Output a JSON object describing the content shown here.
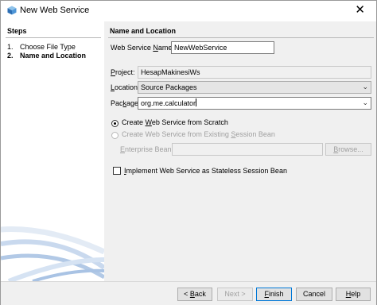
{
  "window": {
    "title": "New Web Service",
    "close_glyph": "✕"
  },
  "steps": {
    "heading": "Steps",
    "items": [
      {
        "num": "1.",
        "label": "Choose File Type"
      },
      {
        "num": "2.",
        "label": "Name and Location"
      }
    ]
  },
  "panel": {
    "heading": "Name and Location",
    "web_service_name": {
      "label_pre": "Web Service ",
      "label_mn": "N",
      "label_post": "ame:",
      "value": "NewWebService"
    },
    "project": {
      "label_mn": "P",
      "label_post": "roject:",
      "value": "HesapMakinesiWs"
    },
    "location": {
      "label_mn": "L",
      "label_post": "ocation:",
      "value": "Source Packages"
    },
    "package": {
      "label_pre": "Pac",
      "label_mn": "k",
      "label_post": "age:",
      "value": "org.me.calculator"
    },
    "radio_scratch": {
      "pre": "Create ",
      "mn": "W",
      "post": "eb Service from Scratch"
    },
    "radio_existing": {
      "pre": "Create Web Service from Existing ",
      "mn": "S",
      "post": "ession Bean"
    },
    "enterprise_bean": {
      "pre": "",
      "mn": "E",
      "post": "nterprise Bean:",
      "value": ""
    },
    "browse_button": {
      "mn": "B",
      "post": "rowse..."
    },
    "stateless_check": {
      "pre": "",
      "mn": "I",
      "post": "mplement Web Service as Stateless Session Bean"
    }
  },
  "buttons": {
    "back": {
      "pre": "< ",
      "mn": "B",
      "post": "ack"
    },
    "next": "Next >",
    "finish": {
      "mn": "F",
      "post": "inish"
    },
    "cancel": "Cancel",
    "help": {
      "mn": "H",
      "post": "elp"
    }
  }
}
